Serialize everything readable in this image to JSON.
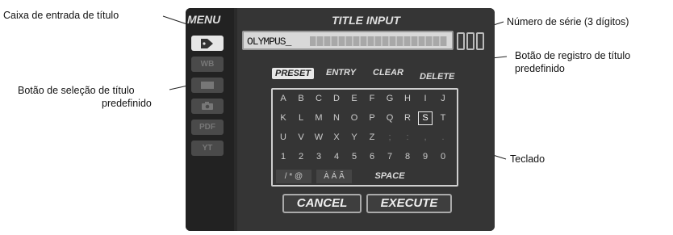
{
  "callouts": {
    "title_box": "Caixa de entrada de título",
    "serial": "Número de série (3 dígitos)",
    "preset_register_1": "Botão de registro de título",
    "preset_register_2": "predefinido",
    "preset_select_1": "Botão de seleção de título",
    "preset_select_2": "predefinido",
    "keyboard": "Teclado"
  },
  "sidebar": {
    "menu_label": "MENU",
    "items": [
      {
        "icon": "tag-icon",
        "label": ""
      },
      {
        "icon": "wb-icon",
        "label": "WB"
      },
      {
        "icon": "folder-icon",
        "label": ""
      },
      {
        "icon": "camera-icon",
        "label": ""
      },
      {
        "icon": "pdf-icon",
        "label": "PDF"
      },
      {
        "icon": "tools-icon",
        "label": "YT"
      }
    ]
  },
  "panel": {
    "title": "TITLE INPUT",
    "title_value": "OLYMPUS_",
    "function_buttons": {
      "preset": "PRESET",
      "entry": "ENTRY",
      "clear": "CLEAR",
      "delete": "DELETE"
    },
    "keyboard": {
      "rows": [
        [
          "A",
          "B",
          "C",
          "D",
          "E",
          "F",
          "G",
          "H",
          "I",
          "J"
        ],
        [
          "K",
          "L",
          "M",
          "N",
          "O",
          "P",
          "Q",
          "R",
          "S",
          "T"
        ],
        [
          "U",
          "V",
          "W",
          "X",
          "Y",
          "Z",
          ";",
          ":",
          ",",
          "."
        ],
        [
          "1",
          "2",
          "3",
          "4",
          "5",
          "6",
          "7",
          "8",
          "9",
          "0"
        ]
      ],
      "symbols_key": "/ * @",
      "accents_key": "À Á Ã",
      "space_key": "SPACE",
      "selected_key": "S"
    },
    "bottom_buttons": {
      "cancel": "CANCEL",
      "execute": "EXECUTE"
    }
  }
}
